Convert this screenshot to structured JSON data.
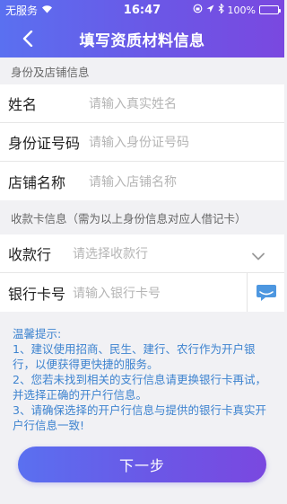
{
  "status_bar": {
    "carrier": "无服务",
    "time": "16:47",
    "battery": "100%"
  },
  "nav": {
    "title": "填写资质材料信息"
  },
  "identity_section": {
    "title": "身份及店铺信息",
    "name_label": "姓名",
    "name_placeholder": "请输入真实姓名",
    "idcard_label": "身份证号码",
    "idcard_placeholder": "请输入身份证号码",
    "shop_label": "店铺名称",
    "shop_placeholder": "请输入店铺名称"
  },
  "card_section": {
    "title": "收款卡信息（需为以上身份信息对应人借记卡）",
    "bank_label": "收款行",
    "bank_placeholder": "请选择收款行",
    "cardno_label": "银行卡号",
    "cardno_placeholder": "请输入银行卡号"
  },
  "tips": {
    "title": "温馨提示:",
    "line1": "1、建议使用招商、民生、建行、农行作为开户银行，以便获得更快捷的服务。",
    "line2": "2、您若未找到相关的支行信息请更换银行卡再试，并选择正确的开户行信息。",
    "line3": "3、请确保选择的开户行信息与提供的银行卡真实开户行信息一致!"
  },
  "next_button": "下一步",
  "colors": {
    "accent_start": "#5a70f0",
    "accent_end": "#7a48e0",
    "tips_text": "#3d83cf"
  }
}
